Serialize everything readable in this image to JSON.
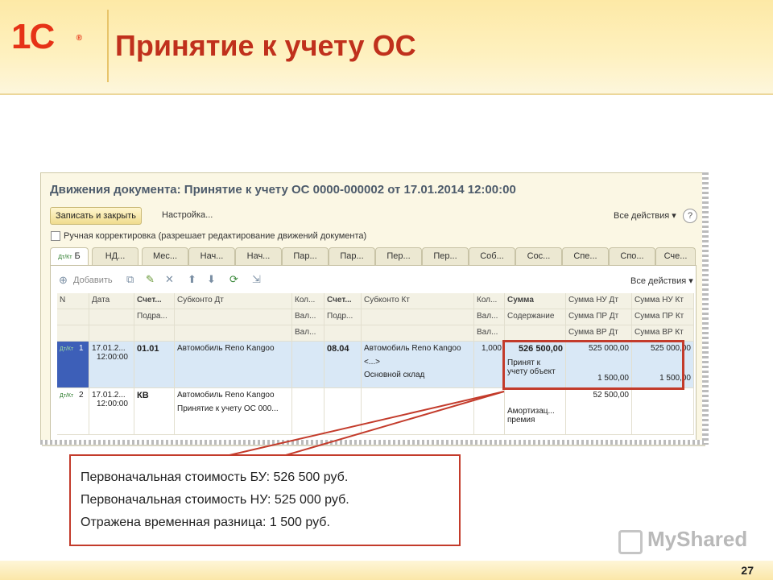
{
  "slide": {
    "logo_text": "1С",
    "logo_reg": "®",
    "title": "Принятие к учету ОС",
    "page_number": "27",
    "watermark": "MyShared"
  },
  "window": {
    "title": "Движения документа: Принятие к учету ОС 0000-000002 от 17.01.2014 12:00:00",
    "save_close_label": "Записать и закрыть",
    "settings_label": "Настройка...",
    "all_actions_label": "Все действия ▾",
    "help_label": "?",
    "manual_correction_label": "Ручная корректировка (разрешает редактирование движений документа)",
    "tabs": [
      "Б",
      "НД...",
      "Мес...",
      "Нач...",
      "Нач...",
      "Пар...",
      "Пар...",
      "Пер...",
      "Пер...",
      "Соб...",
      "Сос...",
      "Спе...",
      "Спо...",
      "Сче..."
    ],
    "tab_icon_text": "Дт/Кт",
    "toolbar": {
      "add_label": "Добавить",
      "all_actions_label": "Все действия ▾"
    }
  },
  "grid": {
    "header_row1": [
      "N",
      "Дата",
      "Счет...",
      "Субконто Дт",
      "Кол...",
      "Счет...",
      "Субконто Кт",
      "Кол...",
      "Сумма",
      "Сумма НУ Дт",
      "Сумма НУ Кт"
    ],
    "header_row2": [
      "",
      "",
      "Подра...",
      "",
      "Вал...",
      "Подр...",
      "",
      "Вал...",
      "Содержание",
      "Сумма ПР Дт",
      "Сумма ПР Кт"
    ],
    "header_row3": [
      "",
      "",
      "",
      "",
      "Вал...",
      "",
      "",
      "Вал...",
      "",
      "Сумма ВР Дт",
      "Сумма ВР Кт"
    ],
    "rows": [
      {
        "n": "1",
        "date": "17.01.2...",
        "time": "12:00:00",
        "acct_dt": "01.01",
        "subconto_dt": "Автомобиль Reno Kangoo",
        "acct_kt": "08.04",
        "subconto_kt_1": "Автомобиль Reno Kangoo",
        "subconto_kt_2": "<...>",
        "subconto_kt_3": "Основной склад",
        "qty_kt": "1,000",
        "sum": "526 500,00",
        "content_1": "Принят к",
        "content_2": "учету объект",
        "sum_nu_dt": "525 000,00",
        "sum_nu_kt": "525 000,00",
        "sum_vr_dt": "1 500,00",
        "sum_vr_kt": "1 500,00"
      },
      {
        "n": "2",
        "date": "17.01.2...",
        "time": "12:00:00",
        "acct_dt": "КВ",
        "subconto_dt_1": "Автомобиль Reno Kangoo",
        "subconto_dt_2": "Принятие к учету ОС 000...",
        "content_1": "Амортизац...",
        "content_2": "премия",
        "sum_nu_dt": "52 500,00"
      }
    ]
  },
  "callout": {
    "line1": "Первоначальная стоимость БУ: 526 500 руб.",
    "line2": "Первоначальная стоимость НУ: 525 000 руб.",
    "line3": "Отражена временная разница: 1 500 руб."
  },
  "colors": {
    "title_red": "#c0301c",
    "highlight_red": "#c33b2b",
    "header_yellow": "#fde9a6",
    "selected_row": "#d9e8f6"
  }
}
